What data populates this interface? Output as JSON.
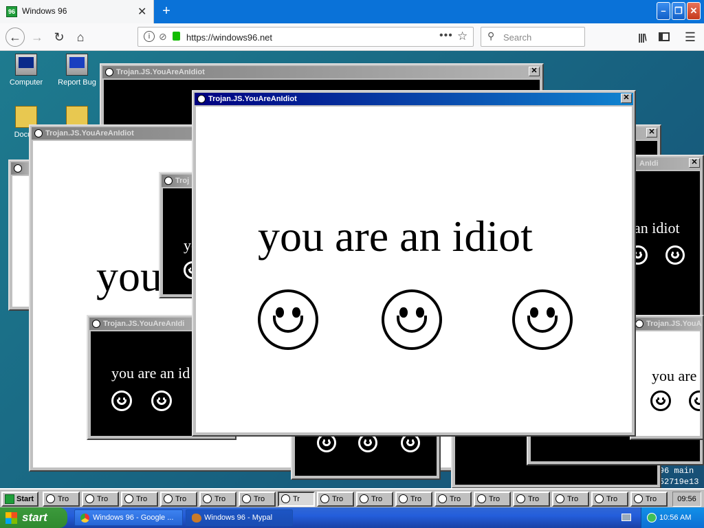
{
  "browser": {
    "tab_title": "Windows 96",
    "favicon_text": "96",
    "url": "https://windows96.net",
    "search_placeholder": "Search",
    "icon_colors": {
      "secure": "#12bc00"
    }
  },
  "desktop": {
    "icons": [
      {
        "label": "Computer"
      },
      {
        "label": "Report Bug"
      },
      {
        "label": "Docum"
      }
    ],
    "background_text_1": "ows 96 main",
    "background_text_2": "fa8052719e13"
  },
  "windows": {
    "title": "Trojan.JS.YouAreAnIdiot",
    "title_short": "Troj",
    "title_trunc1": "Trojan.JS.YouAreAnIdi",
    "title_trunc2": "Trojan.JS.YouAreAnIdi",
    "title_trunc3": "Trojan.JS.YouAr",
    "title_trunc4": "AnIdi",
    "message": "you are an idiot",
    "message_partial1": "you",
    "message_partial2": "yo",
    "message_partial3": "you are an id",
    "message_partial4": "an idiot",
    "message_partial5": "you are",
    "close_glyph": "✕"
  },
  "w96_taskbar": {
    "start_label": "Start",
    "task_label": "Tro",
    "active_task_label": "Tr",
    "clock": "09:56"
  },
  "xp_taskbar": {
    "start_label": "start",
    "tasks": [
      {
        "label": "Windows 96 - Google ..."
      },
      {
        "label": "Windows 96 - Mypal"
      }
    ],
    "clock": "10:56 AM"
  }
}
